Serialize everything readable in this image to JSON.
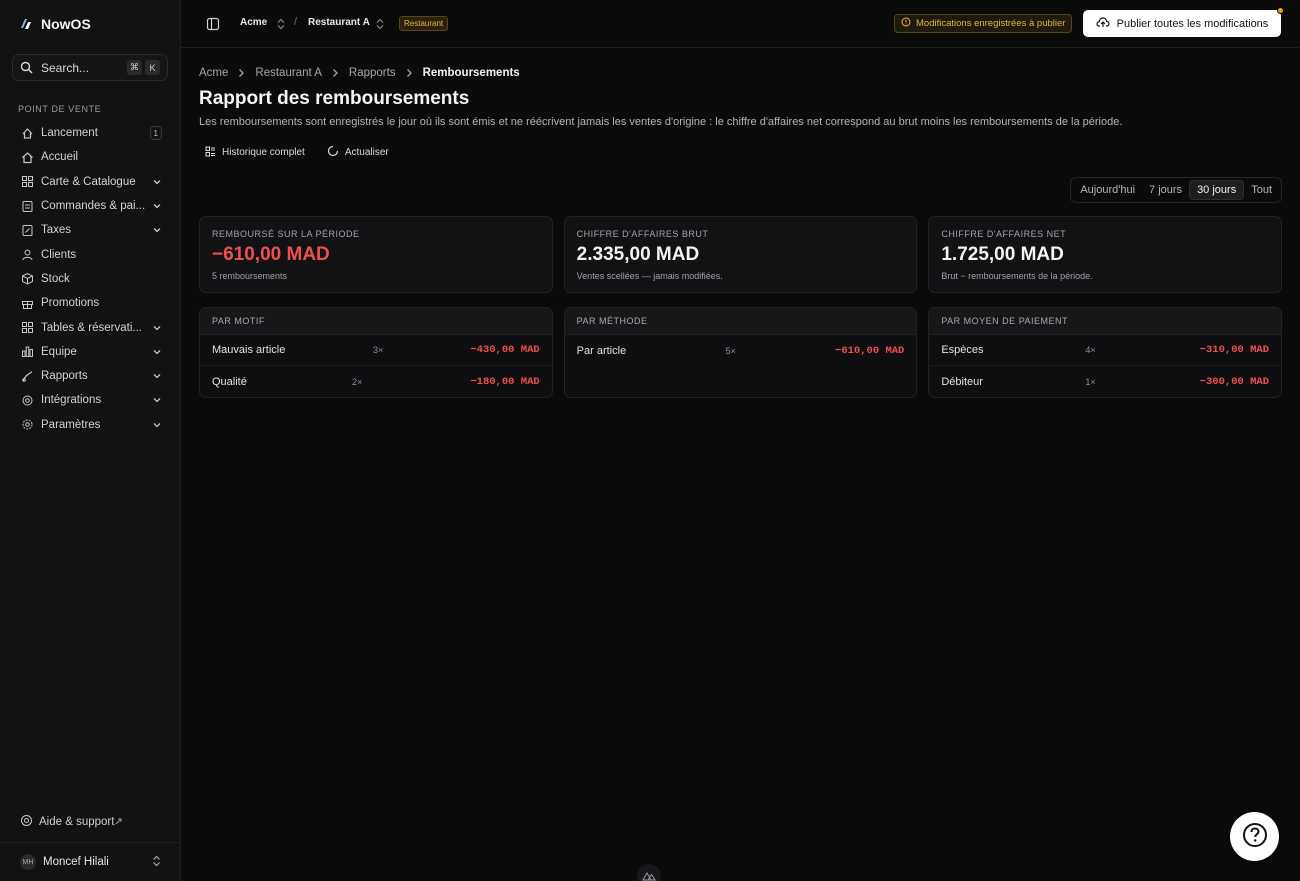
{
  "app": {
    "name": "NowOS"
  },
  "search": {
    "label": "Search...",
    "kbd1": "⌘",
    "kbd2": "K"
  },
  "sidebar": {
    "section": "POINT DE VENTE",
    "items": [
      {
        "label": "Lancement",
        "icon": "rocket-icon",
        "badge": "1"
      },
      {
        "label": "Accueil",
        "icon": "home-icon"
      },
      {
        "label": "Carte & Catalogue",
        "icon": "grid-icon",
        "expandable": true
      },
      {
        "label": "Commandes & pai...",
        "icon": "receipt-icon",
        "expandable": true
      },
      {
        "label": "Taxes",
        "icon": "tax-icon",
        "expandable": true
      },
      {
        "label": "Clients",
        "icon": "users-icon"
      },
      {
        "label": "Stock",
        "icon": "box-icon"
      },
      {
        "label": "Promotions",
        "icon": "gift-icon"
      },
      {
        "label": "Tables & réservati...",
        "icon": "table-icon",
        "expandable": true
      },
      {
        "label": "Équipe",
        "icon": "team-icon",
        "expandable": true
      },
      {
        "label": "Rapports",
        "icon": "chart-icon",
        "expandable": true
      },
      {
        "label": "Intégrations",
        "icon": "plug-icon",
        "expandable": true
      },
      {
        "label": "Paramètres",
        "icon": "gear-icon",
        "expandable": true
      }
    ],
    "help": "Aide & support",
    "user": {
      "initials": "MH",
      "name": "Moncef Hilali"
    }
  },
  "topbar": {
    "org": "Acme",
    "restaurant": "Restaurant A",
    "tag": "Restaurant",
    "pending": "Modifications enregistrées à publier",
    "publish": "Publier toutes les modifications"
  },
  "breadcrumb": [
    "Acme",
    "Restaurant A",
    "Rapports",
    "Remboursements"
  ],
  "page": {
    "title": "Rapport des remboursements",
    "description": "Les remboursements sont enregistrés le jour où ils sont émis et ne réécrivent jamais les ventes d'origine : le chiffre d'affaires net correspond au brut moins les remboursements de la période.",
    "actions": {
      "history": "Historique complet",
      "refresh": "Actualiser"
    },
    "ranges": [
      "Aujourd'hui",
      "7 jours",
      "30 jours",
      "Tout"
    ],
    "active_range": "30 jours"
  },
  "kpis": [
    {
      "label": "REMBOURSÉ SUR LA PÉRIODE",
      "value": "−610,00 MAD",
      "sub": "5 remboursements"
    },
    {
      "label": "CHIFFRE D'AFFAIRES BRUT",
      "value": "2.335,00 MAD",
      "sub": "Ventes scellées — jamais modifiées."
    },
    {
      "label": "CHIFFRE D'AFFAIRES NET",
      "value": "1.725,00 MAD",
      "sub": "Brut − remboursements de la période."
    }
  ],
  "breakdowns": {
    "motif": {
      "title": "PAR MOTIF",
      "rows": [
        {
          "name": "Mauvais article",
          "count": "3×",
          "amount": "−430,00 MAD"
        },
        {
          "name": "Qualité",
          "count": "2×",
          "amount": "−180,00 MAD"
        }
      ]
    },
    "methode": {
      "title": "PAR MÉTHODE",
      "rows": [
        {
          "name": "Par article",
          "count": "5×",
          "amount": "−610,00 MAD"
        }
      ]
    },
    "paiement": {
      "title": "PAR MOYEN DE PAIEMENT",
      "rows": [
        {
          "name": "Espèces",
          "count": "4×",
          "amount": "−310,00 MAD"
        },
        {
          "name": "Débiteur",
          "count": "1×",
          "amount": "−300,00 MAD"
        }
      ]
    }
  }
}
